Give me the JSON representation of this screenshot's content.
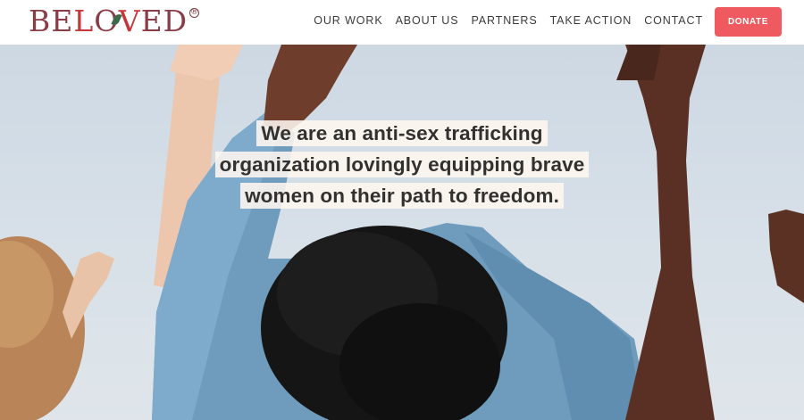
{
  "brand": {
    "name": "BELOVED",
    "registered_mark": "®"
  },
  "nav": {
    "items": [
      {
        "label": "OUR WORK"
      },
      {
        "label": "ABOUT US"
      },
      {
        "label": "PARTNERS"
      },
      {
        "label": "TAKE ACTION"
      },
      {
        "label": "CONTACT"
      }
    ],
    "donate_label": "DONATE"
  },
  "hero": {
    "lines": [
      "We are an anti-sex trafficking",
      "organization lovingly equipping brave",
      "women on their path to freedom."
    ]
  },
  "colors": {
    "accent": "#ee5a5f",
    "brand_text": "#7a3a44",
    "sky": "#d7e0e8"
  }
}
